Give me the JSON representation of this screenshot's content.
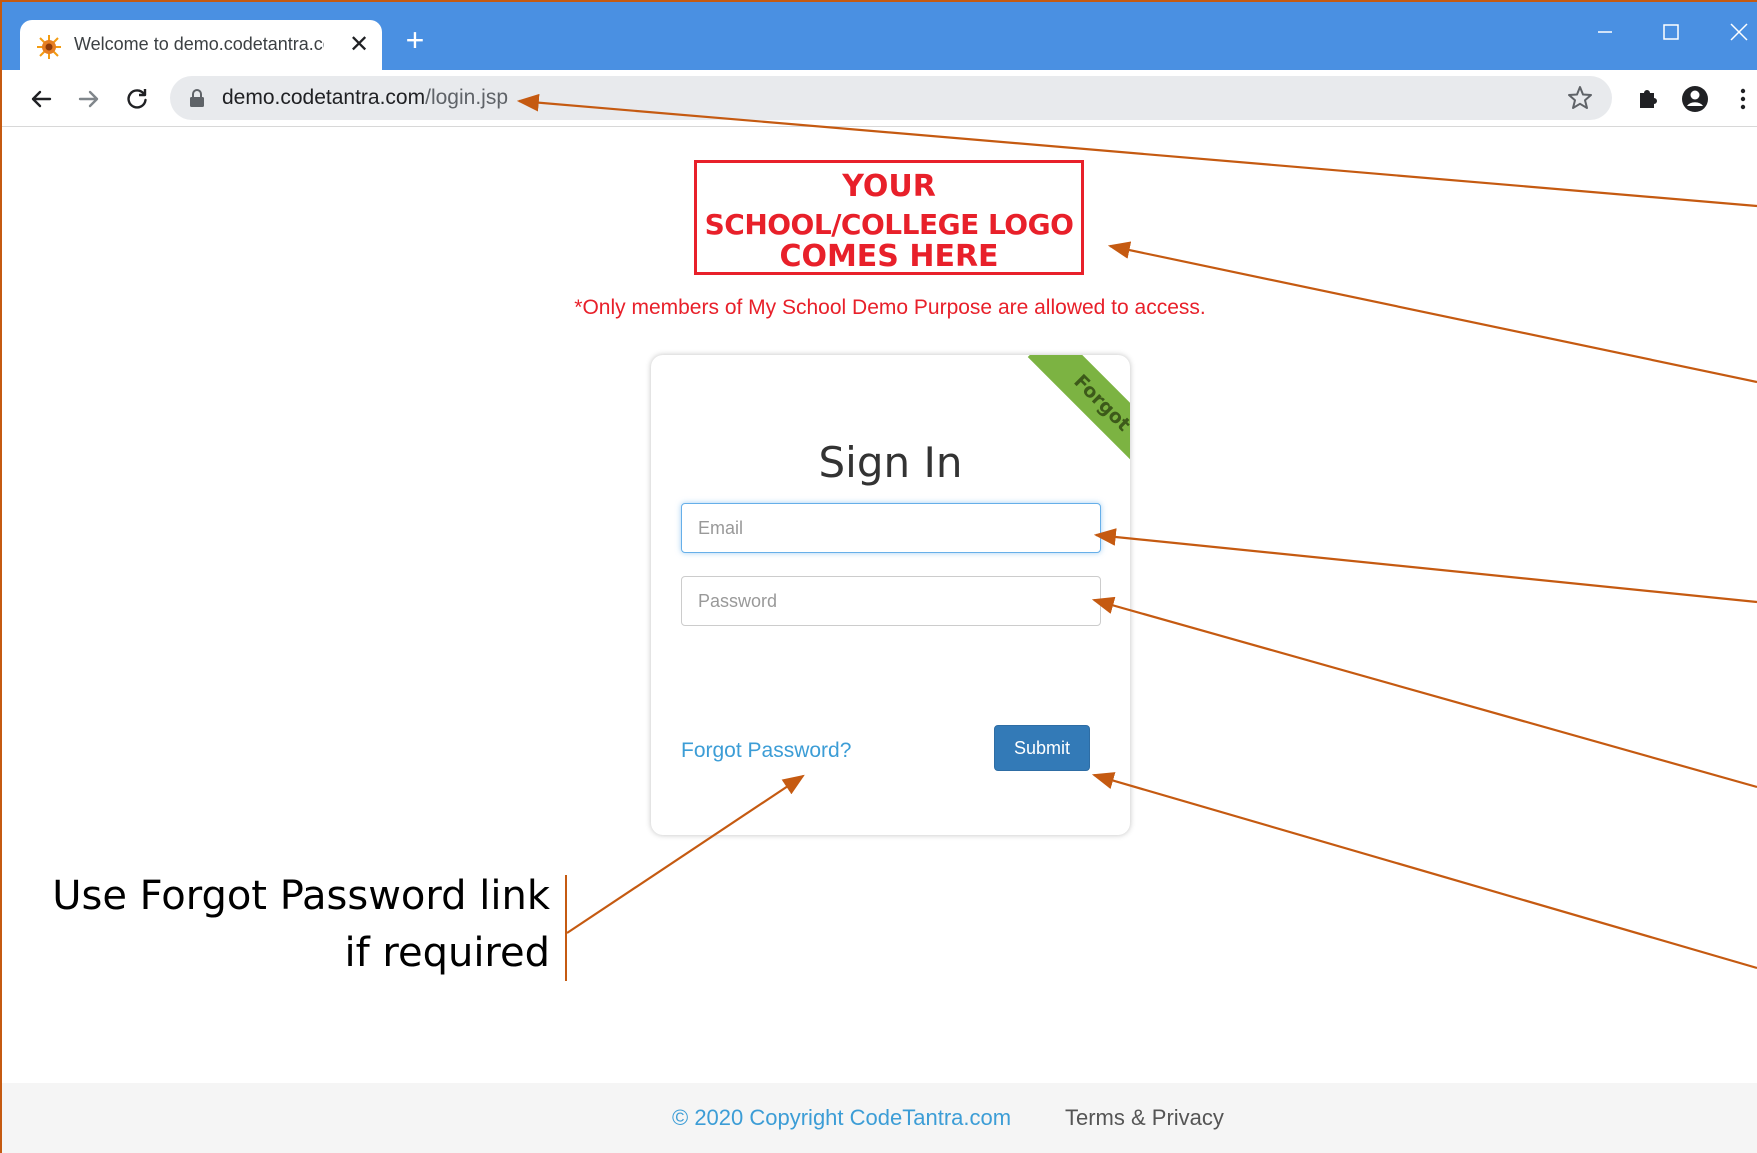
{
  "browser": {
    "tab_title": "Welcome to demo.codetantra.com",
    "url_host": "demo.codetantra.com",
    "url_path": "/login.jsp",
    "icons": [
      "back-icon",
      "forward-icon",
      "reload-icon",
      "lock-icon",
      "star-icon",
      "extensions-icon",
      "profile-icon",
      "menu-icon",
      "minimize-icon",
      "maximize-icon",
      "close-icon"
    ]
  },
  "logo": {
    "line1": "YOUR",
    "line2": "SCHOOL/COLLEGE LOGO",
    "line3": "COMES HERE"
  },
  "notice": "*Only members of My School Demo Purpose are allowed to access.",
  "login": {
    "ribbon": "Forgot",
    "title": "Sign In",
    "email_placeholder": "Email",
    "password_placeholder": "Password",
    "forgot_link": "Forgot Password?",
    "submit_label": "Submit"
  },
  "annotation": {
    "line1": "Use Forgot Password link",
    "line2": "if required"
  },
  "footer": {
    "copyright": "© 2020 Copyright CodeTantra.com",
    "terms": "Terms & Privacy"
  },
  "colors": {
    "tabstrip": "#4a90e2",
    "logo_red": "#e8202a",
    "ribbon_green": "#7cb342",
    "submit_blue": "#337ab7",
    "link_blue": "#3c9dd6",
    "arrow_orange": "#c55a11"
  }
}
